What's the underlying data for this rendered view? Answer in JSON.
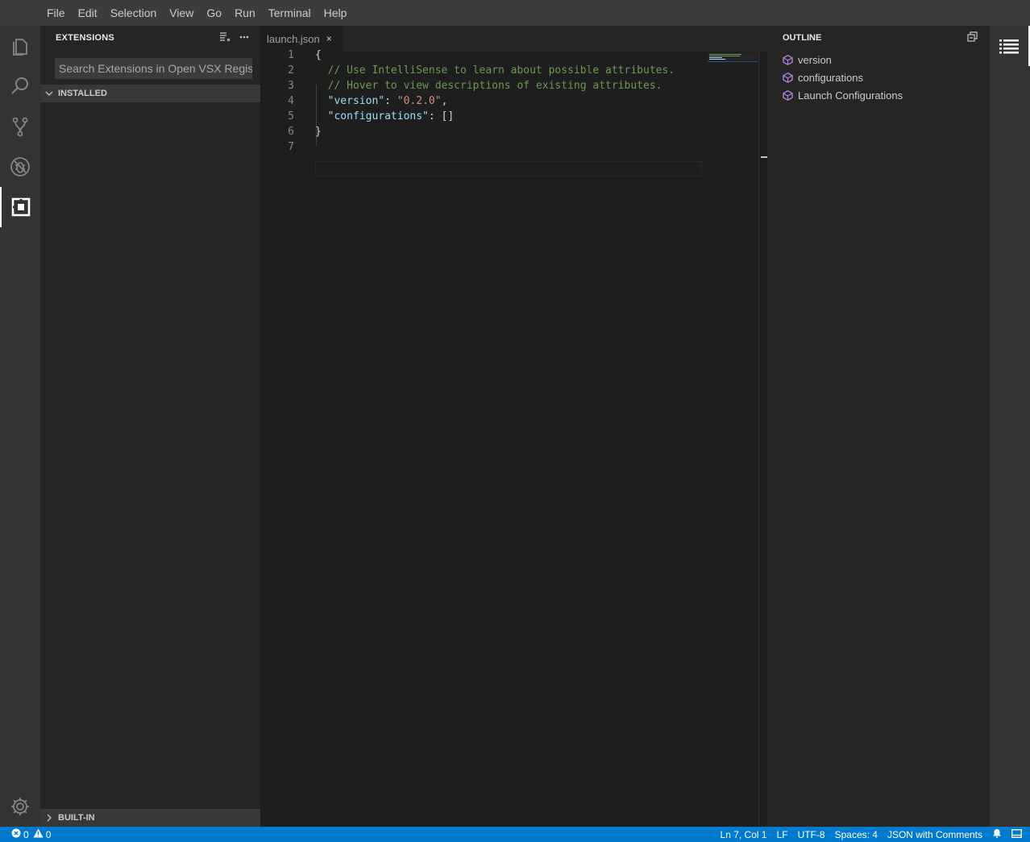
{
  "menubar": {
    "items": [
      "File",
      "Edit",
      "Selection",
      "View",
      "Go",
      "Run",
      "Terminal",
      "Help"
    ]
  },
  "activitybar": {
    "icons": [
      "explorer-icon",
      "search-icon",
      "source-control-icon",
      "debug-icon",
      "extensions-icon",
      "settings-gear-icon"
    ]
  },
  "sidebar": {
    "title": "EXTENSIONS",
    "search_placeholder": "Search Extensions in Open VSX Registry",
    "sections": {
      "installed": "INSTALLED",
      "builtin": "BUILT-IN"
    }
  },
  "editor": {
    "tab": {
      "label": "launch.json",
      "close": "×"
    },
    "lines": [
      {
        "num": "1",
        "parts": [
          {
            "t": "{",
            "c": "plain"
          }
        ]
      },
      {
        "num": "2",
        "parts": [
          {
            "t": "  // Use IntelliSense to learn about possible attributes.",
            "c": "cmt"
          }
        ]
      },
      {
        "num": "3",
        "parts": [
          {
            "t": "  // Hover to view descriptions of existing attributes.",
            "c": "cmt"
          }
        ]
      },
      {
        "num": "4",
        "parts": [
          {
            "t": "  ",
            "c": "plain"
          },
          {
            "t": "\"version\"",
            "c": "key"
          },
          {
            "t": ": ",
            "c": "plain"
          },
          {
            "t": "\"0.2.0\"",
            "c": "str"
          },
          {
            "t": ",",
            "c": "plain"
          }
        ]
      },
      {
        "num": "5",
        "parts": [
          {
            "t": "  ",
            "c": "plain"
          },
          {
            "t": "\"configurations\"",
            "c": "key"
          },
          {
            "t": ": []",
            "c": "plain"
          }
        ]
      },
      {
        "num": "6",
        "parts": [
          {
            "t": "}",
            "c": "plain"
          }
        ]
      },
      {
        "num": "7",
        "parts": [
          {
            "t": "",
            "c": "plain"
          }
        ]
      }
    ]
  },
  "outline": {
    "title": "OUTLINE",
    "items": [
      "version",
      "configurations",
      "Launch Configurations"
    ]
  },
  "statusbar": {
    "errors": "0",
    "warnings": "0",
    "position": "Ln 7, Col 1",
    "eol": "LF",
    "encoding": "UTF-8",
    "indent": "Spaces: 4",
    "language": "JSON with Comments"
  },
  "colors": {
    "accent": "#007acc",
    "comment": "#6a9955",
    "json_key": "#9cdcfe",
    "string": "#ce9178",
    "outline_icon": "#b180d7"
  }
}
